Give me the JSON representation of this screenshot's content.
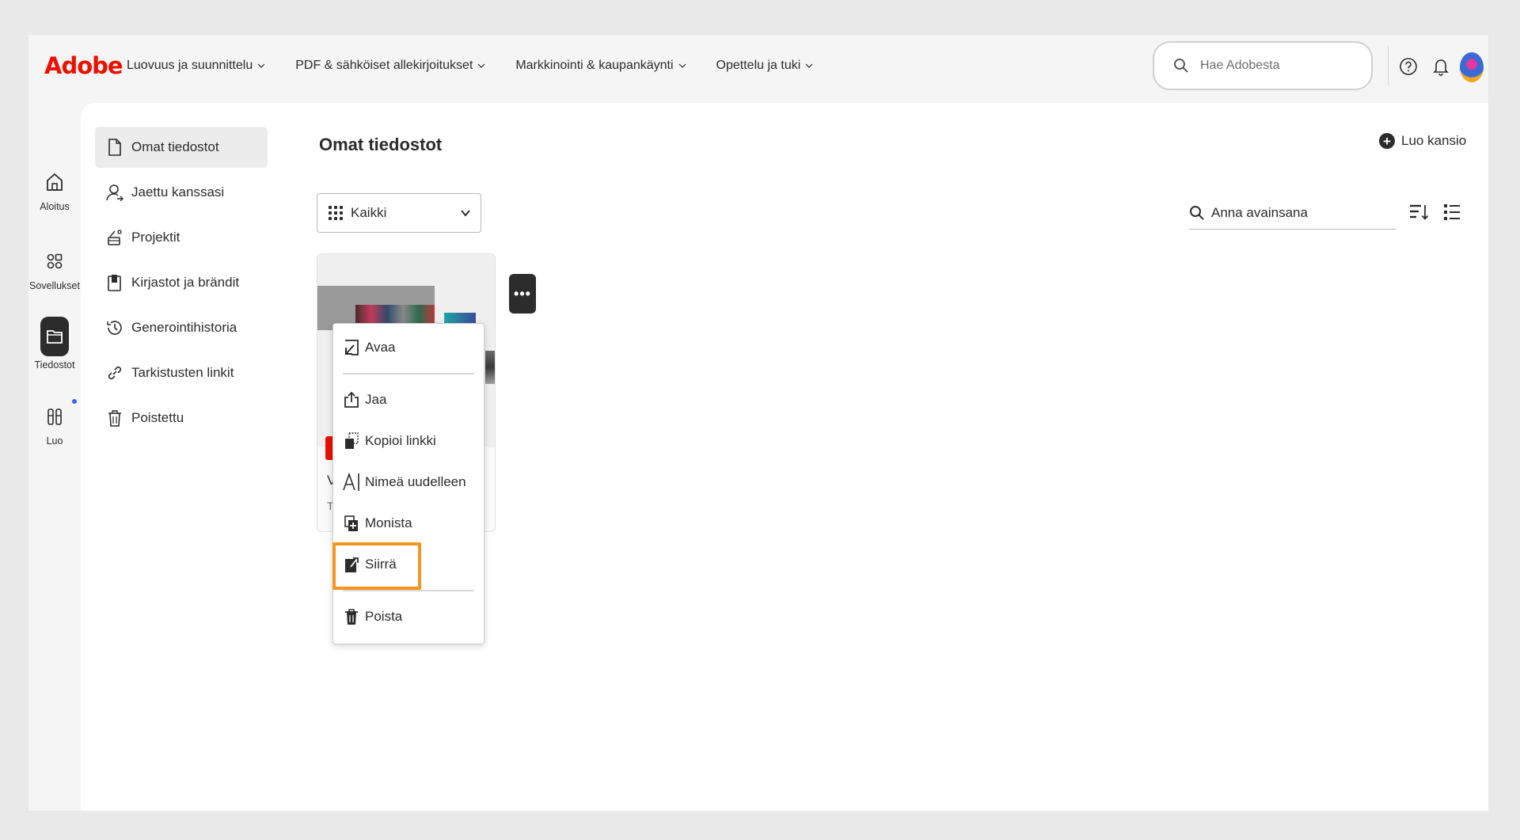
{
  "brand": {
    "logo": "Adobe",
    "accent": "#eb1000"
  },
  "topnav": [
    {
      "label": "Luovuus ja suunnittelu"
    },
    {
      "label": "PDF & sähköiset allekirjoitukset"
    },
    {
      "label": "Markkinointi & kaupankäynti"
    },
    {
      "label": "Opettelu ja tuki"
    }
  ],
  "search": {
    "placeholder": "Hae Adobesta"
  },
  "rail": [
    {
      "label": "Aloitus",
      "icon": "home-icon"
    },
    {
      "label": "Sovellukset",
      "icon": "apps-icon"
    },
    {
      "label": "Tiedostot",
      "icon": "folder-icon",
      "active": true
    },
    {
      "label": "Luo",
      "icon": "create-icon"
    }
  ],
  "subnav": [
    {
      "label": "Omat tiedostot",
      "icon": "file-icon",
      "active": true
    },
    {
      "label": "Jaettu kanssasi",
      "icon": "shared-user-icon"
    },
    {
      "label": "Projektit",
      "icon": "projects-icon"
    },
    {
      "label": "Kirjastot ja brändit",
      "icon": "library-icon"
    },
    {
      "label": "Generointihistoria",
      "icon": "history-icon"
    },
    {
      "label": "Tarkistusten linkit",
      "icon": "link-icon"
    },
    {
      "label": "Poistettu",
      "icon": "trash-icon"
    }
  ],
  "main": {
    "title": "Omat tiedostot",
    "new_folder": "Luo kansio",
    "filter_value": "Kaikki",
    "keyword_placeholder": "Anna avainsana"
  },
  "card": {
    "name_initial": "V",
    "meta_initial": "T"
  },
  "context_menu": {
    "items": [
      {
        "label": "Avaa",
        "icon": "open-icon"
      },
      {
        "label": "Jaa",
        "icon": "share-icon"
      },
      {
        "label": "Kopioi linkki",
        "icon": "copy-link-icon"
      },
      {
        "label": "Nimeä uudelleen",
        "icon": "rename-icon"
      },
      {
        "label": "Monista",
        "icon": "duplicate-icon"
      },
      {
        "label": "Siirrä",
        "icon": "move-icon",
        "highlighted": true
      },
      {
        "label": "Poista",
        "icon": "delete-icon"
      }
    ],
    "highlight_color": "#f7941d"
  }
}
